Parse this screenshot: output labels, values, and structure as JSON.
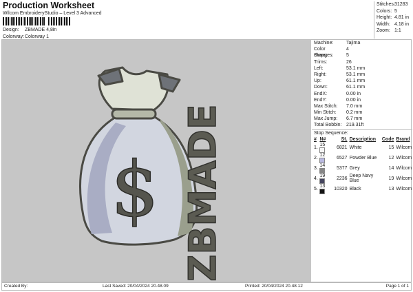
{
  "header": {
    "title": "Production Worksheet",
    "software": "Wilcom EmbroideryStudio – Level 3 Advanced",
    "design_label": "Design:",
    "design": "ZBMADE 4,8in",
    "colorway_label": "Colorway:",
    "colorway": "Colorway 1"
  },
  "summary": [
    {
      "k": "Stitches:",
      "v": "31283"
    },
    {
      "k": "Colors:",
      "v": "5"
    },
    {
      "k": "Height:",
      "v": "4.81 in"
    },
    {
      "k": "Width:",
      "v": "4.18 in"
    },
    {
      "k": "Zoom:",
      "v": "1:1"
    }
  ],
  "details": [
    {
      "k": "Machine:",
      "v": "Tajima"
    },
    {
      "k": "Color changes:",
      "v": "4"
    },
    {
      "k": "Stops:",
      "v": "5"
    },
    {
      "k": "Trims:",
      "v": "26"
    },
    {
      "k": "Left:",
      "v": "53.1 mm"
    },
    {
      "k": "Right:",
      "v": "53.1 mm"
    },
    {
      "k": "Up:",
      "v": "61.1 mm"
    },
    {
      "k": "Down:",
      "v": "61.1 mm"
    },
    {
      "k": "EndX:",
      "v": "0.00 in"
    },
    {
      "k": "EndY:",
      "v": "0.00 in"
    },
    {
      "k": "Max Stitch:",
      "v": "7.0 mm"
    },
    {
      "k": "Min Stitch:",
      "v": "0.2 mm"
    },
    {
      "k": "Max Jump:",
      "v": "6.7 mm"
    },
    {
      "k": "Total Bobbin:",
      "v": "219.31ft"
    }
  ],
  "stop_sequence": {
    "label": "Stop Sequence:",
    "headers": [
      "#",
      "N#",
      "St.",
      "Description",
      "Code",
      "Brand"
    ],
    "rows": [
      {
        "idx": "1.",
        "n": "15",
        "color": "#f4f4f4",
        "st": "6821",
        "desc": "White",
        "code": "15",
        "brand": "Wilcom"
      },
      {
        "idx": "2.",
        "n": "12",
        "color": "#b9b9e0",
        "st": "6527",
        "desc": "Powder Blue",
        "code": "12",
        "brand": "Wilcom"
      },
      {
        "idx": "3.",
        "n": "14",
        "color": "#858585",
        "st": "5377",
        "desc": "Grey",
        "code": "14",
        "brand": "Wilcom"
      },
      {
        "idx": "4.",
        "n": "19",
        "color": "#45455e",
        "st": "2236",
        "desc": "Deep Navy Blue",
        "code": "19",
        "brand": "Wilcom"
      },
      {
        "idx": "5.",
        "n": "13",
        "color": "#141414",
        "st": "10320",
        "desc": "Black",
        "code": "13",
        "brand": "Wilcom"
      }
    ]
  },
  "design_art": {
    "text": "ZBMADE",
    "symbol": "$"
  },
  "footer": {
    "created_by": "Created By:",
    "last_saved": "Last Saved: 20/04/2024 20.48.09",
    "printed": "Printed: 20/04/2024 20.48.12",
    "page": "Page 1 of 1"
  }
}
